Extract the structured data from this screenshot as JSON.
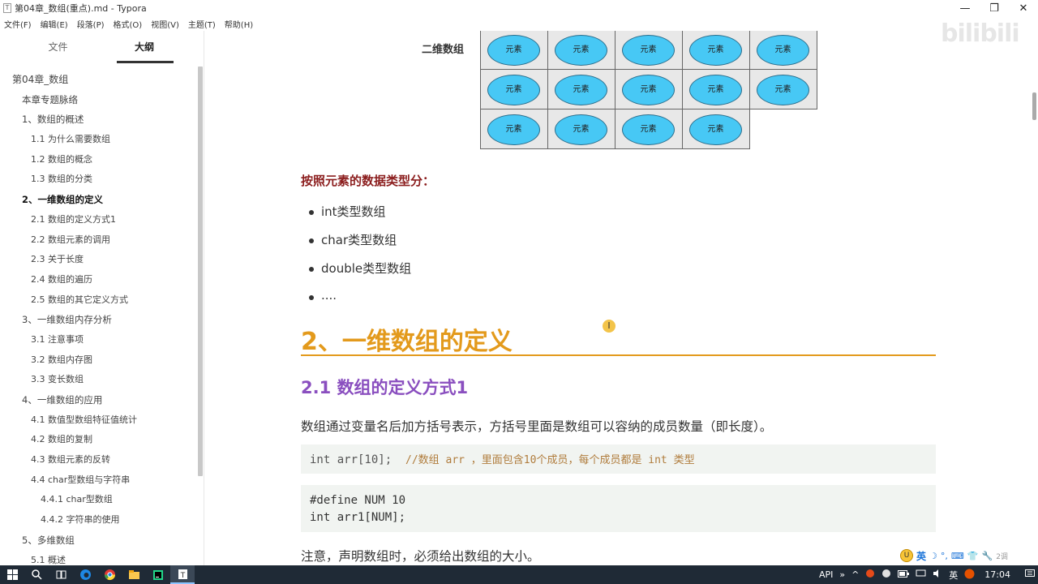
{
  "window": {
    "icon_letter": "T",
    "title": "第04章_数组(重点).md - Typora",
    "controls": [
      "—",
      "❐",
      "✕"
    ]
  },
  "menu": [
    "文件(F)",
    "编辑(E)",
    "段落(P)",
    "格式(O)",
    "视图(V)",
    "主题(T)",
    "帮助(H)"
  ],
  "sidebar": {
    "tabs": [
      "文件",
      "大纲"
    ],
    "active_tab": "大纲",
    "outline": [
      {
        "label": "第04章_数组",
        "level": 1
      },
      {
        "label": "本章专题脉络",
        "level": 2
      },
      {
        "label": "1、数组的概述",
        "level": 2
      },
      {
        "label": "1.1 为什么需要数组",
        "level": 3
      },
      {
        "label": "1.2 数组的概念",
        "level": 3
      },
      {
        "label": "1.3 数组的分类",
        "level": 3
      },
      {
        "label": "2、一维数组的定义",
        "level": 2,
        "active": true
      },
      {
        "label": "2.1 数组的定义方式1",
        "level": 3
      },
      {
        "label": "2.2 数组元素的调用",
        "level": 3
      },
      {
        "label": "2.3 关于长度",
        "level": 3
      },
      {
        "label": "2.4 数组的遍历",
        "level": 3
      },
      {
        "label": "2.5 数组的其它定义方式",
        "level": 3
      },
      {
        "label": "3、一维数组内存分析",
        "level": 2
      },
      {
        "label": "3.1 注意事项",
        "level": 3
      },
      {
        "label": "3.2 数组内存图",
        "level": 3
      },
      {
        "label": "3.3 变长数组",
        "level": 3
      },
      {
        "label": "4、一维数组的应用",
        "level": 2
      },
      {
        "label": "4.1 数值型数组特征值统计",
        "level": 3
      },
      {
        "label": "4.2 数组的复制",
        "level": 3
      },
      {
        "label": "4.3 数组元素的反转",
        "level": 3
      },
      {
        "label": "4.4 char型数组与字符串",
        "level": 3
      },
      {
        "label": "4.4.1 char型数组",
        "level": 4
      },
      {
        "label": "4.4.2 字符串的使用",
        "level": 4
      },
      {
        "label": "5、多维数组",
        "level": 2
      },
      {
        "label": "5.1 概述",
        "level": 3
      }
    ],
    "footer": [
      "‹",
      "</>"
    ]
  },
  "content": {
    "grid_label": "二维数组",
    "grid_element": "元素",
    "grid_rows": [
      5,
      5,
      4
    ],
    "red_heading": "按照元素的数据类型分：",
    "bullets": [
      "int类型数组",
      "char类型数组",
      "double类型数组",
      "...."
    ],
    "h2": "2、一维数组的定义",
    "h3": "2.1 数组的定义方式1",
    "paragraph": "数组通过变量名后加方括号表示，方括号里面是数组可以容纳的成员数量（即长度）。",
    "code1": {
      "code": "int arr[10];",
      "comment": "//数组 arr ，里面包含10个成员，每个成员都是 int 类型"
    },
    "code2": [
      "#define NUM 10",
      "int arr1[NUM];"
    ],
    "note": "注意，声明数组时，必须给出数组的大小。",
    "cursor_glyph": "I"
  },
  "watermark": "bilibili",
  "ime": {
    "logo": "U",
    "lang": "英",
    "icons": [
      "☽",
      "°,",
      "⌨",
      "👕",
      "🔧"
    ],
    "extra": "2调"
  },
  "taskbar": {
    "apps": [
      "search-icon",
      "task-view-icon",
      "edge-icon",
      "chrome-icon",
      "explorer-icon",
      "pycharm-icon",
      "typora-icon"
    ],
    "tray": {
      "api_label": "API",
      "chevron": "»",
      "caret": "^",
      "lang": "英",
      "time": "17:04"
    }
  },
  "colors": {
    "h2": "#e39a1c",
    "h3": "#8a4fbf",
    "red_heading": "#8b1d1d",
    "ellipse": "#47c8f5",
    "taskbar": "#1f2a36"
  }
}
